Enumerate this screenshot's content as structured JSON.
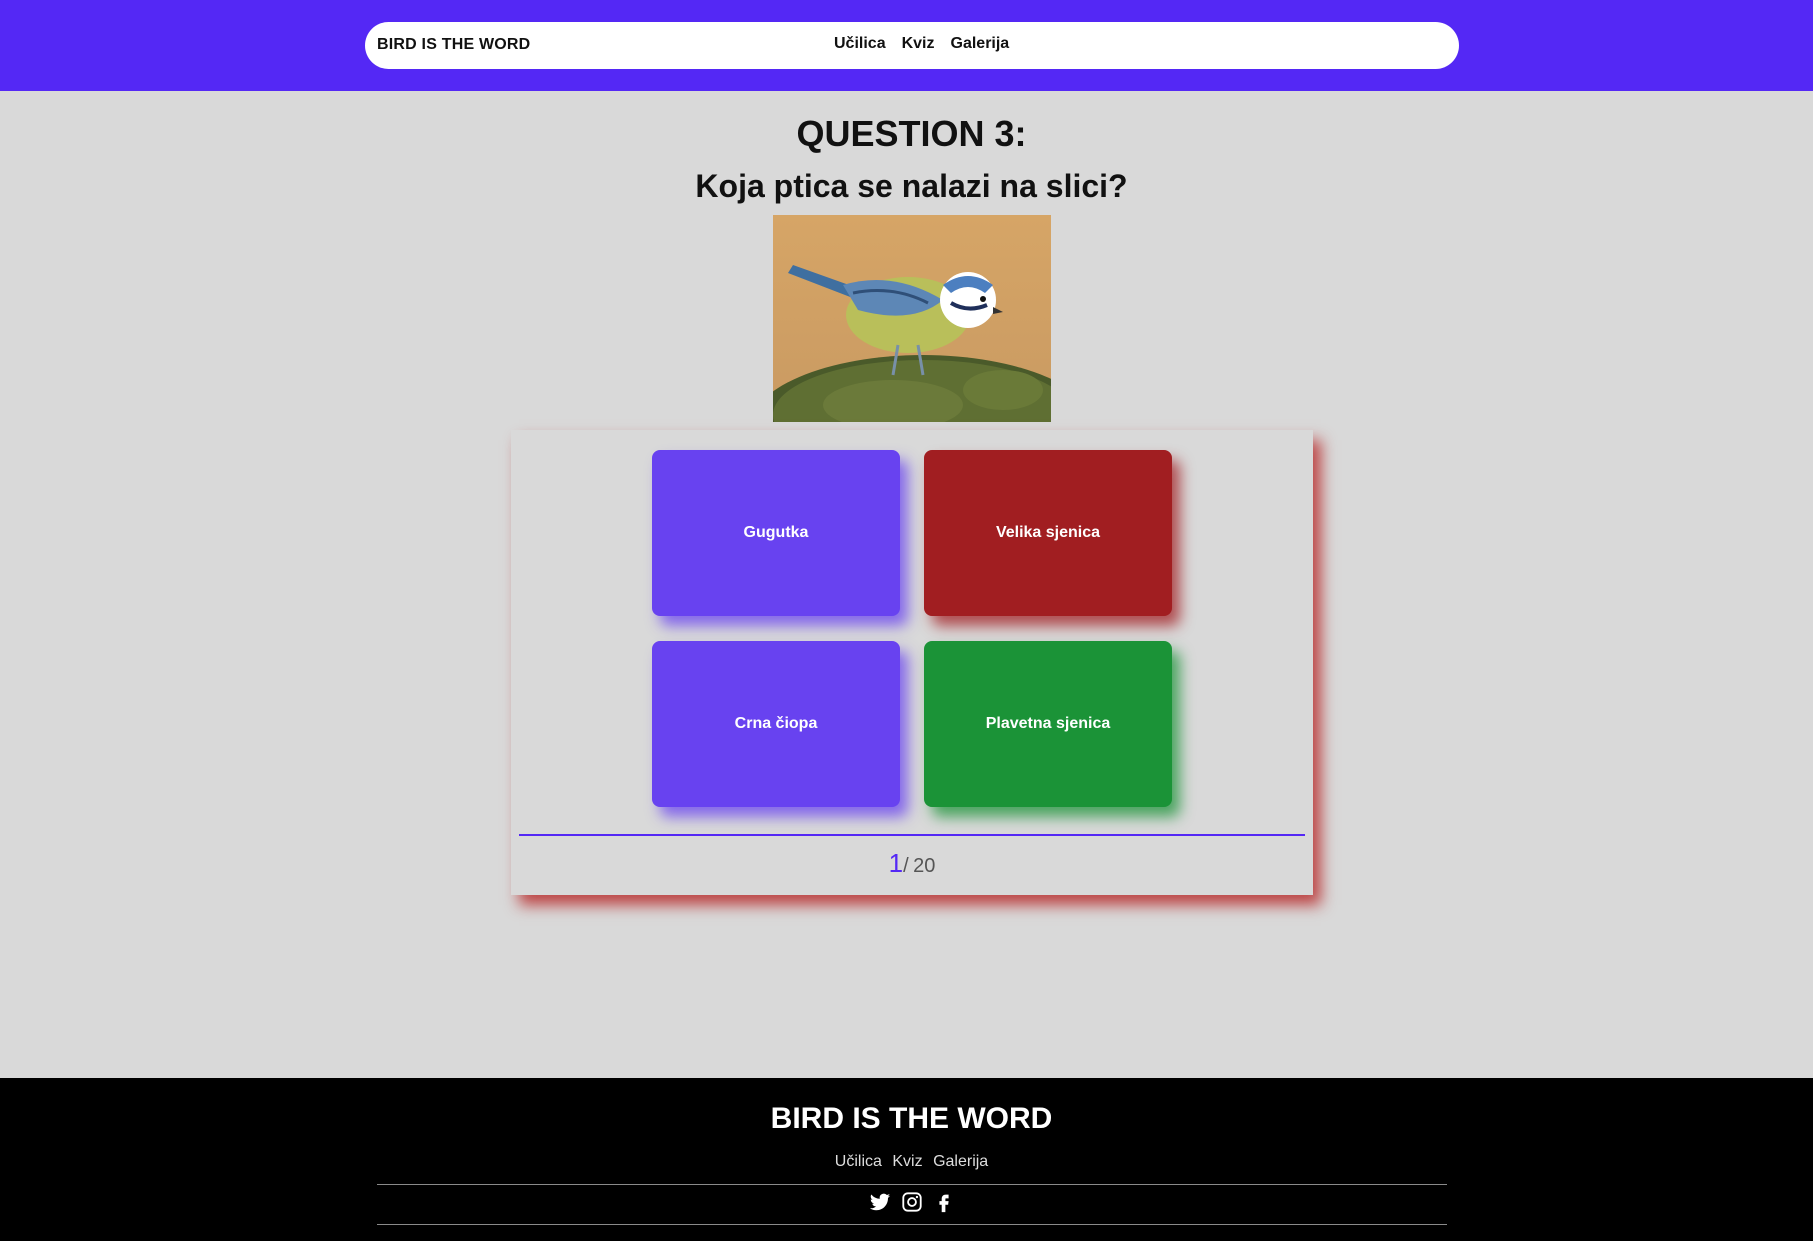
{
  "header": {
    "brand": "BIRD IS THE WORD",
    "nav": [
      "Učilica",
      "Kviz",
      "Galerija"
    ],
    "background_color": "#5428f5"
  },
  "question": {
    "title": "QUESTION 3:",
    "text": "Koja ptica se nalazi na slici?"
  },
  "answers": [
    {
      "label": "Gugutka",
      "color": "#6842f0"
    },
    {
      "label": "Velika sjenica",
      "color": "#a11e21"
    },
    {
      "label": "Crna čiopa",
      "color": "#6842f0"
    },
    {
      "label": "Plavetna sjenica",
      "color": "#1b9337"
    }
  ],
  "progress": {
    "current": "1",
    "separator": "/",
    "total": "20"
  },
  "footer": {
    "title": "BIRD IS THE WORD",
    "links": [
      "Učilica",
      "Kviz",
      "Galerija"
    ],
    "social_icons": [
      "twitter-icon",
      "instagram-icon",
      "facebook-icon"
    ]
  }
}
